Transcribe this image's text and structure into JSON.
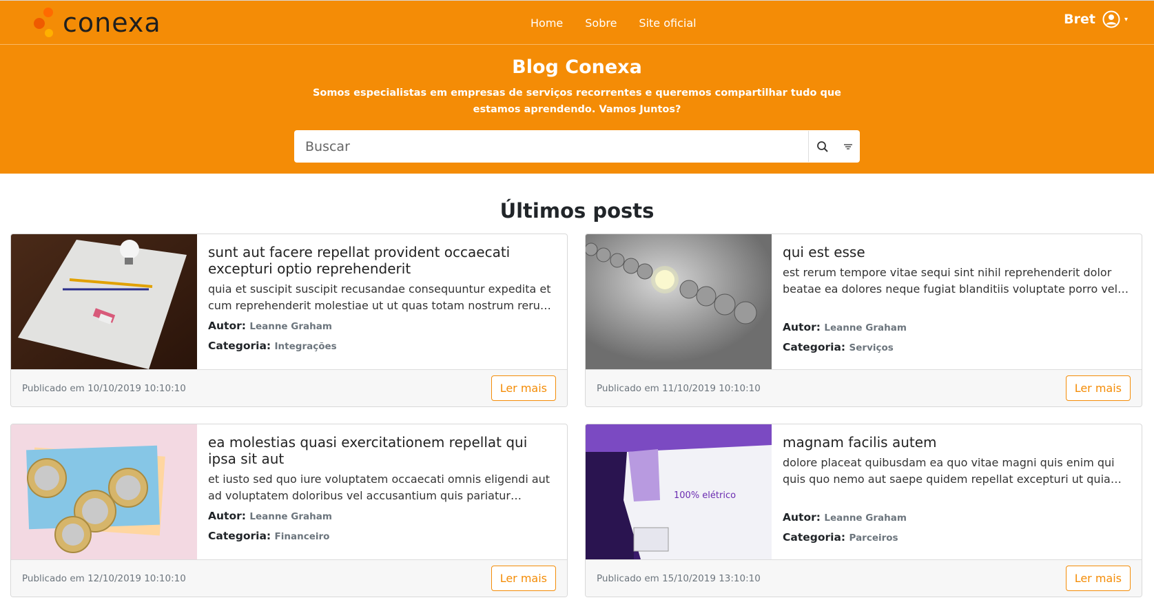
{
  "nav": {
    "brand": "conexa",
    "links": [
      "Home",
      "Sobre",
      "Site oficial"
    ],
    "user": "Bret"
  },
  "hero": {
    "title": "Blog Conexa",
    "subtitle": "Somos especialistas em empresas de serviços recorrentes e queremos compartilhar tudo que estamos aprendendo. Vamos Juntos?",
    "search_placeholder": "Buscar"
  },
  "section_title": "Últimos posts",
  "labels": {
    "author": "Autor:",
    "category": "Categoria:",
    "read_more": "Ler mais"
  },
  "posts": [
    {
      "title": "sunt aut facere repellat provident occaecati excepturi optio reprehenderit",
      "excerpt": "quia et suscipit suscipit recusandae consequuntur expedita et cum reprehenderit molestiae ut ut quas totam nostrum rerum est autem sunt rem eveniet architecto",
      "author": "Leanne Graham",
      "category": "Integrações",
      "published": "Publicado em 10/10/2019 10:10:10"
    },
    {
      "title": "qui est esse",
      "excerpt": "est rerum tempore vitae sequi sint nihil reprehenderit dolor beatae ea dolores neque fugiat blanditiis voluptate porro vel nihil molestiae ut reiciendis",
      "author": "Leanne Graham",
      "category": "Serviços",
      "published": "Publicado em 11/10/2019 10:10:10"
    },
    {
      "title": "ea molestias quasi exercitationem repellat qui ipsa sit aut",
      "excerpt": "et iusto sed quo iure voluptatem occaecati omnis eligendi aut ad voluptatem doloribus vel accusantium quis pariatur molestiae porro eius odio et labore",
      "author": "Leanne Graham",
      "category": "Financeiro",
      "published": "Publicado em 12/10/2019 10:10:10"
    },
    {
      "title": "magnam facilis autem",
      "excerpt": "dolore placeat quibusdam ea quo vitae magni quis enim qui quis quo nemo aut saepe quidem repellat excepturi ut quia sunt ut sequi eos ea sed quas",
      "author": "Leanne Graham",
      "category": "Parceiros",
      "published": "Publicado em 15/10/2019 13:10:10"
    }
  ],
  "image_text": {
    "truck": "100% elétrico"
  },
  "colors": {
    "primary": "#f48c06",
    "muted": "#6c757d"
  }
}
